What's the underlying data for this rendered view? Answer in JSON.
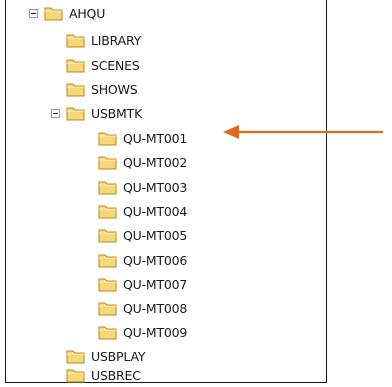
{
  "tree": {
    "root": {
      "label": "AHQU",
      "expanded": true
    },
    "root_children": [
      {
        "label": "LIBRARY"
      },
      {
        "label": "SCENES"
      },
      {
        "label": "SHOWS"
      }
    ],
    "usbmtk": {
      "label": "USBMTK",
      "expanded": true
    },
    "usbmtk_children": [
      {
        "label": "QU-MT001"
      },
      {
        "label": "QU-MT002"
      },
      {
        "label": "QU-MT003"
      },
      {
        "label": "QU-MT004"
      },
      {
        "label": "QU-MT005"
      },
      {
        "label": "QU-MT006"
      },
      {
        "label": "QU-MT007"
      },
      {
        "label": "QU-MT008"
      },
      {
        "label": "QU-MT009"
      }
    ],
    "root_children_after": [
      {
        "label": "USBPLAY"
      },
      {
        "label": "USBREC"
      }
    ]
  },
  "colors": {
    "folder_fill": "#f6d77a",
    "folder_stroke": "#b88a1a",
    "arrow": "#e06a1a"
  },
  "icons": {
    "folder": "folder-icon",
    "expander": "collapse-toggle-icon",
    "pointer": "arrow-left-icon"
  }
}
